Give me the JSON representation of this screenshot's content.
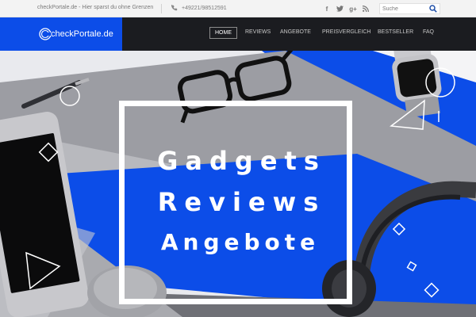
{
  "topbar": {
    "tagline": "checkPortale.de - Hier sparst du ohne Grenzen",
    "phone": "+49221/98512591",
    "social": [
      "facebook-icon",
      "twitter-icon",
      "google-plus-icon",
      "rss-icon"
    ],
    "search_placeholder": "Suche"
  },
  "header": {
    "logo_text": "checkPortale.de",
    "nav": [
      "HOME",
      "REVIEWS",
      "ANGEBOTE",
      "PREISVERGLEICH",
      "BESTSELLER",
      "FAQ"
    ],
    "active_nav": "HOME"
  },
  "hero": {
    "lines": [
      "Gadgets",
      "Reviews",
      "Angebote"
    ]
  },
  "colors": {
    "brand_blue": "#0c4de8",
    "dark": "#1b1c20",
    "topbar_bg": "#f3f3f3"
  }
}
